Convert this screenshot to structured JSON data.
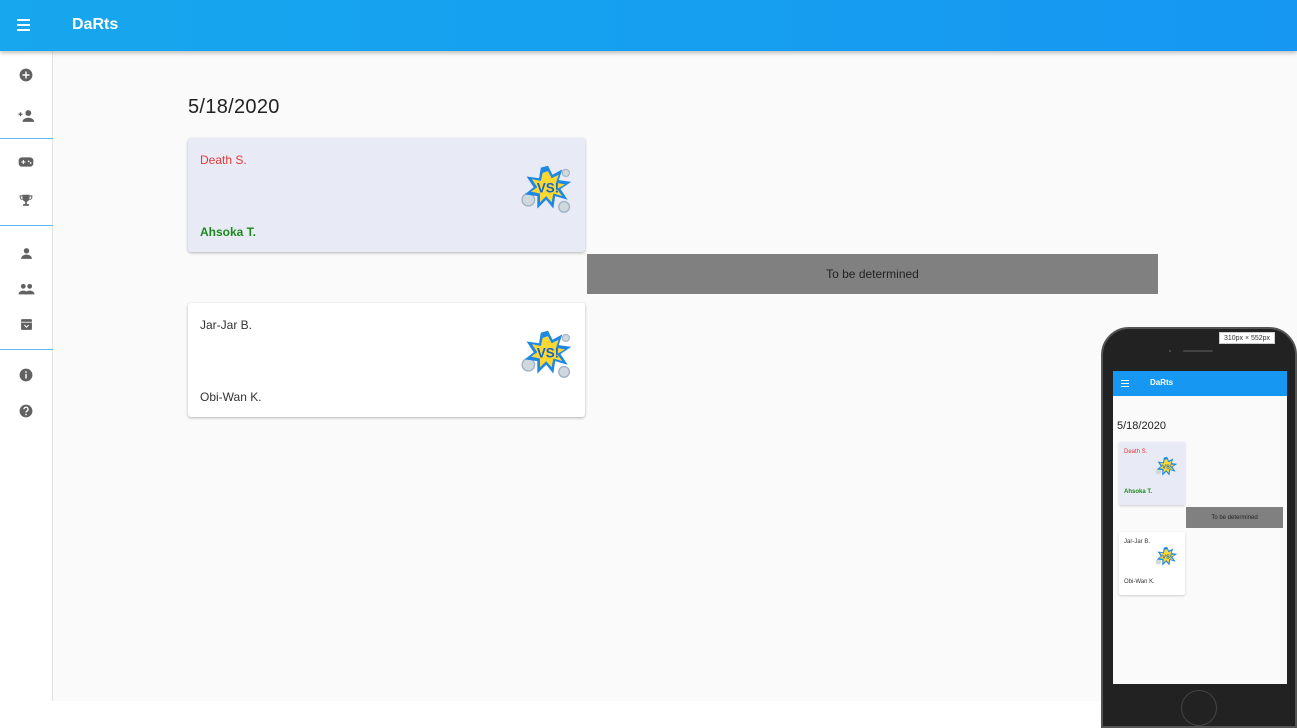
{
  "app": {
    "title": "DaRts"
  },
  "sidebar": {
    "items": [
      {
        "icon": "add-circle-icon"
      },
      {
        "icon": "add-person-icon"
      },
      {
        "icon": "gamepad-icon"
      },
      {
        "icon": "trophy-icon"
      },
      {
        "icon": "person-icon"
      },
      {
        "icon": "people-icon"
      },
      {
        "icon": "archive-icon"
      },
      {
        "icon": "info-icon"
      },
      {
        "icon": "help-icon"
      }
    ]
  },
  "main": {
    "date": "5/18/2020",
    "matches": [
      {
        "player1": "Death S.",
        "player2": "Ahsoka T.",
        "player1_color": "#e53935",
        "player2_color": "#1b8a1b",
        "highlight": true
      },
      {
        "player1": "Jar-Jar B.",
        "player2": "Obi-Wan K.",
        "player1_color": "#333333",
        "player2_color": "#333333",
        "highlight": false
      }
    ],
    "tbd_label": "To be determined"
  },
  "preview": {
    "dimensions": "310px × 552px",
    "title": "DaRts",
    "date": "5/18/2020",
    "tbd_label": "To be determined"
  },
  "colors": {
    "accent": "#1597f2",
    "highlight_card": "#e8eaf6",
    "loser": "#e53935",
    "winner": "#1b8a1b",
    "tbd_bg": "#808080"
  }
}
